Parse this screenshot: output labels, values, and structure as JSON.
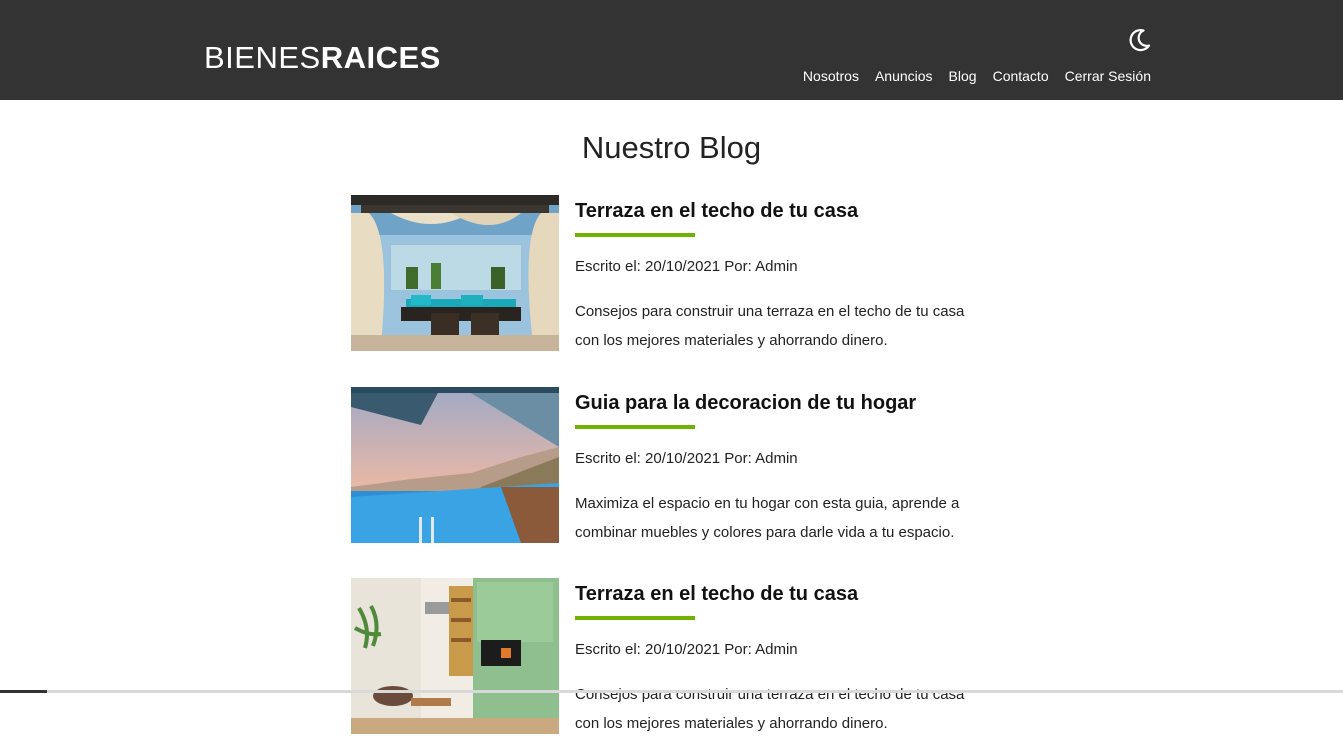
{
  "header": {
    "logo_light": "BIENES",
    "logo_bold": "RAICES",
    "theme_icon": "moon-icon",
    "nav": [
      "Nosotros",
      "Anuncios",
      "Blog",
      "Contacto",
      "Cerrar Sesión"
    ]
  },
  "main": {
    "title": "Nuestro Blog",
    "entries": [
      {
        "title": "Terraza en el techo de tu casa",
        "meta": "Escrito el: 20/10/2021 Por: Admin",
        "description": "Consejos para construir una terraza en el techo de tu casa con los mejores materiales y ahorrando dinero.",
        "image": "rooftop-terrace-photo"
      },
      {
        "title": "Guia para la decoracion de tu hogar",
        "meta": "Escrito el: 20/10/2021 Por: Admin",
        "description": "Maximiza el espacio en tu hogar con esta guia, aprende a combinar muebles y colores para darle vida a tu espacio.",
        "image": "infinity-pool-photo"
      },
      {
        "title": "Terraza en el techo de tu casa",
        "meta": "Escrito el: 20/10/2021 Por: Admin",
        "description": "Consejos para construir una terraza en el techo de tu casa con los mejores materiales y ahorrando dinero.",
        "image": "living-room-photo"
      }
    ]
  },
  "colors": {
    "header_bg": "#333333",
    "accent": "#71b100",
    "text": "#111111"
  }
}
